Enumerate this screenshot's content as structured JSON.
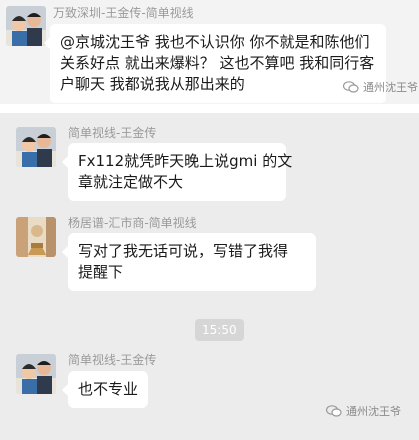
{
  "top_message": {
    "sender": "万致深圳-王金传-简单视线",
    "text": "@京城沈王爷 我也不认识你  你不就是和陈他们关系好点 就出来爆料？ 这也不算吧 我和同行客户聊天 我都说我从那出来的",
    "avatar_icon": "couple-photo-avatar"
  },
  "watermark_top": "通州沈王爷",
  "messages": [
    {
      "sender": "简单视线-王金传",
      "text_line1": "Fx112就凭昨天晚上说gmi 的文",
      "text_line2": "章就注定做不大",
      "avatar_icon": "couple-photo-avatar"
    },
    {
      "sender": "杨居谱-汇市商-简单视线",
      "text_line1": "写对了我无话可说，写错了我得",
      "text_line2": "提醒下",
      "avatar_icon": "monk-statue-avatar"
    }
  ],
  "timestamp": "15:50",
  "last_message": {
    "sender": "简单视线-王金传",
    "text": "也不专业",
    "avatar_icon": "couple-photo-avatar"
  },
  "watermark_bottom": "通州沈王爷",
  "colors": {
    "panel_top_bg": "#f3f3f3",
    "panel_main_bg": "#ececec",
    "bubble_bg": "#ffffff"
  }
}
